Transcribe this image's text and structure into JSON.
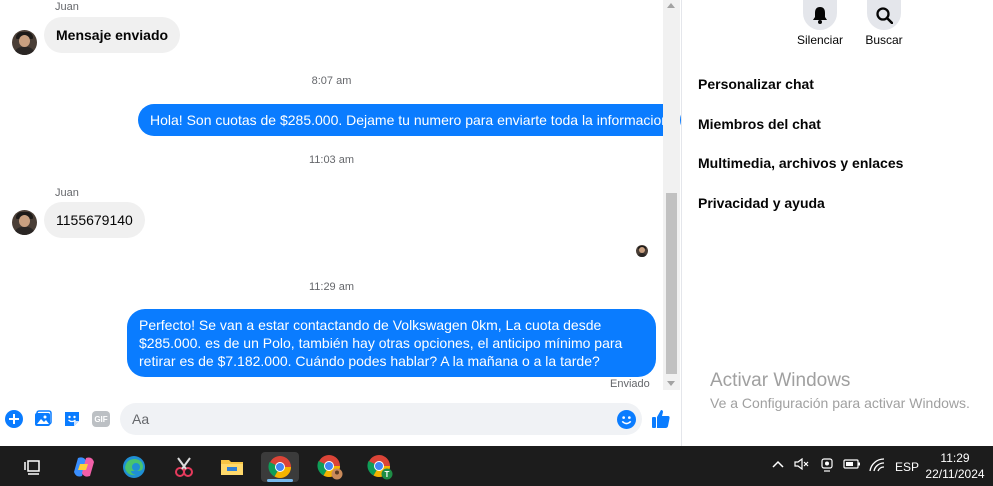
{
  "chat": {
    "messages": [
      {
        "sender": "Juan",
        "text": "Mensaje enviado"
      },
      {
        "timestamp": "8:07 am"
      },
      {
        "text": "Hola! Son cuotas de $285.000. Dejame tu numero para enviarte toda la informacion"
      },
      {
        "timestamp": "11:03 am"
      },
      {
        "sender": "Juan",
        "text": "1155679140"
      },
      {
        "timestamp": "11:29 am"
      },
      {
        "text": "Perfecto!  Se van a estar contactando de Volkswagen 0km, La cuota desde $285.000. es de un Polo, también hay otras opciones, el anticipo mínimo para retirar es de $7.182.000. Cuándo podes hablar? A la mañana o a la tarde?",
        "status": "Enviado"
      }
    ],
    "composer": {
      "placeholder": "Aa",
      "icons": [
        "plus-circle-icon",
        "photo-icon",
        "sticker-icon",
        "gif-icon",
        "emoji-icon",
        "thumbs-up-icon"
      ],
      "gif_label": "GIF"
    }
  },
  "details": {
    "actions": [
      {
        "label": "Silenciar",
        "icon": "bell-icon"
      },
      {
        "label": "Buscar",
        "icon": "search-icon"
      }
    ],
    "menu": [
      "Personalizar chat",
      "Miembros del chat",
      "Multimedia, archivos y enlaces",
      "Privacidad y ayuda"
    ]
  },
  "watermark": {
    "title": "Activar Windows",
    "subtitle": "Ve a Configuración para activar Windows."
  },
  "taskbar": {
    "apps": [
      "task-view-icon",
      "copilot-icon",
      "edge-icon",
      "snipping-tool-icon",
      "file-explorer-icon",
      "chrome-icon",
      "chrome-profile-icon",
      "chrome-profile-t-icon"
    ],
    "chrome_profile_letter": "T",
    "language": "ESP",
    "time": "11:29",
    "date": "22/11/2024"
  },
  "colors": {
    "accent": "#0a7cff",
    "incoming_bubble": "#f0f0f0",
    "taskbar": "#1c1c1c"
  }
}
